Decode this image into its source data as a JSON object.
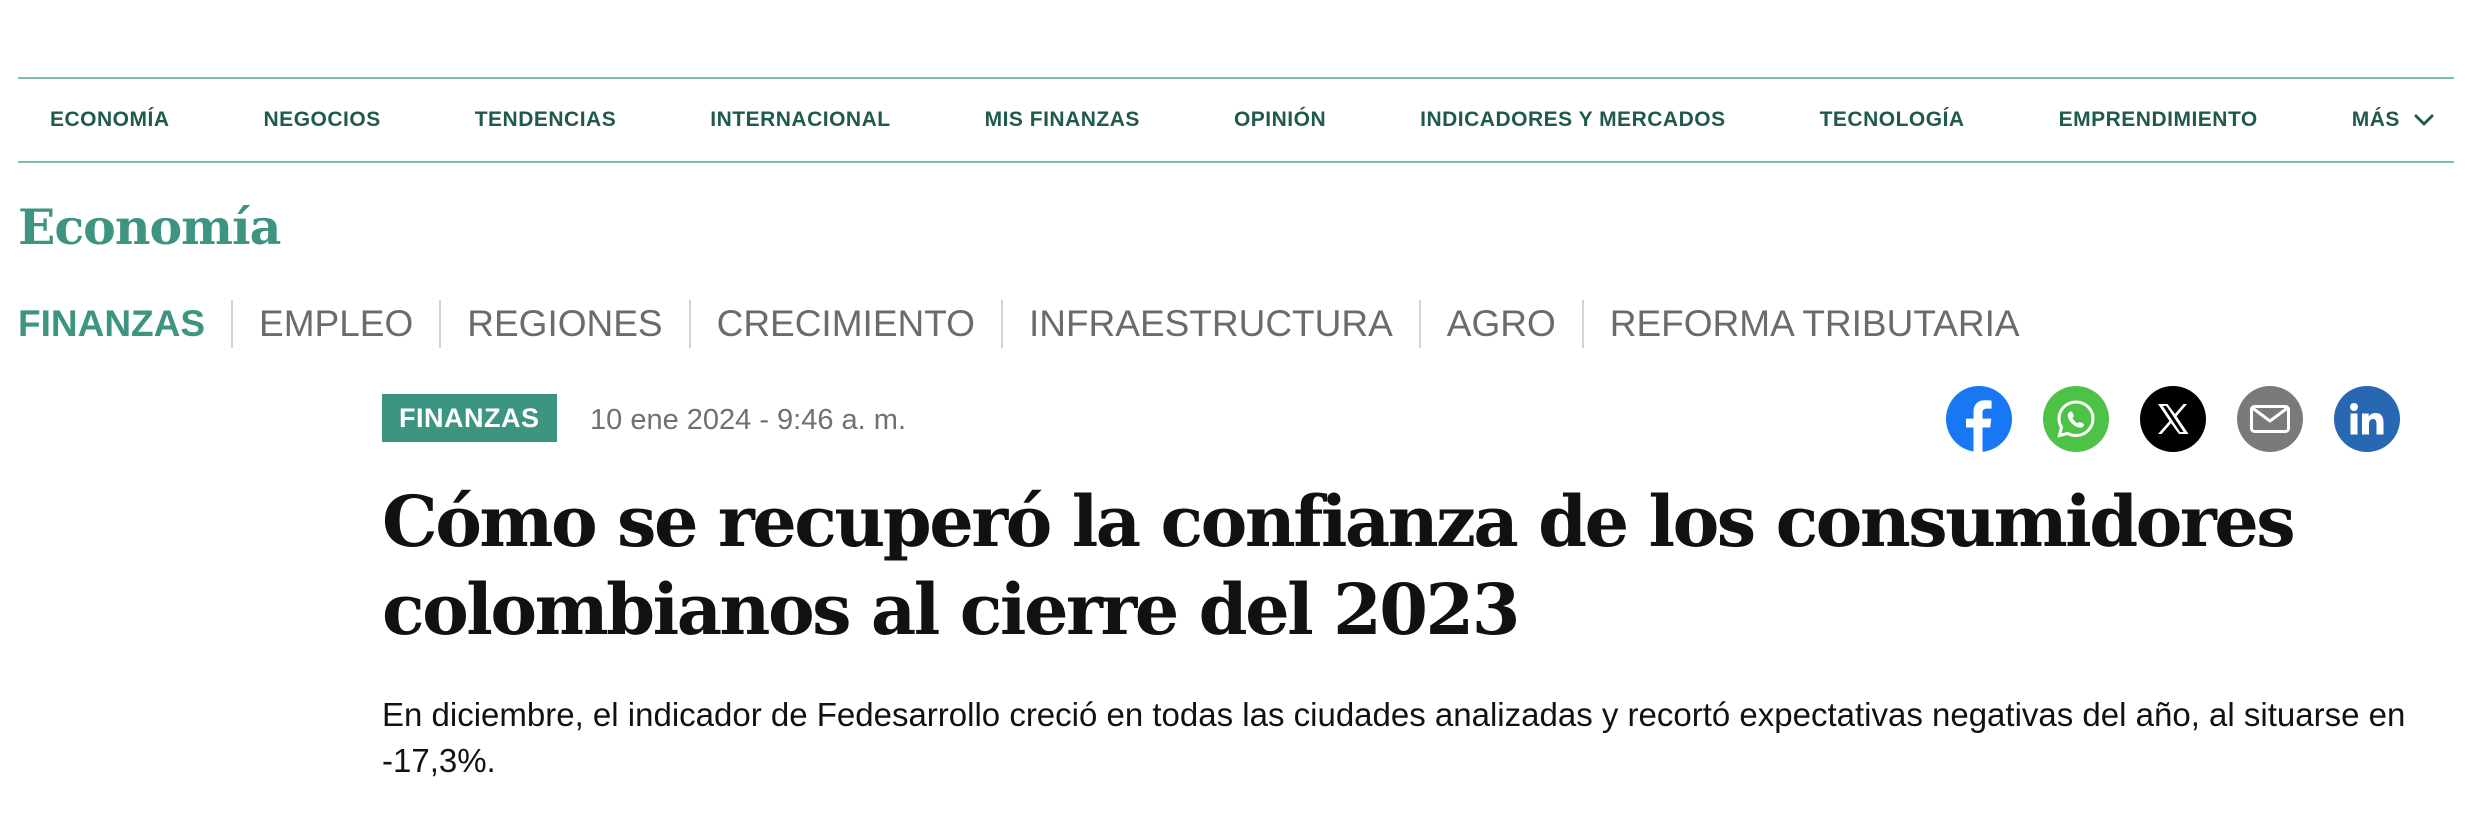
{
  "topnav": {
    "items": [
      "ECONOMÍA",
      "NEGOCIOS",
      "TENDENCIAS",
      "INTERNACIONAL",
      "MIS FINANZAS",
      "OPINIÓN",
      "INDICADORES Y MERCADOS",
      "TECNOLOGÍA",
      "EMPRENDIMIENTO"
    ],
    "more_label": "MÁS",
    "more_icon": "chevron-down-icon"
  },
  "section": {
    "title": "Economía"
  },
  "subnav": {
    "items": [
      "FINANZAS",
      "EMPLEO",
      "REGIONES",
      "CRECIMIENTO",
      "INFRAESTRUCTURA",
      "AGRO",
      "REFORMA TRIBUTARIA"
    ],
    "active": "FINANZAS"
  },
  "article": {
    "category": "FINANZAS",
    "date": "10 ene 2024 - 9:46 a. m.",
    "headline": "Cómo se recuperó la confianza de los consumidores colombianos al cierre del 2023",
    "summary": "En diciembre, el indicador de Fedesarrollo creció en todas las ciudades analizadas y recortó expectativas negativas del año, al situarse en -17,3%."
  },
  "share": [
    {
      "icon": "facebook-icon",
      "color": "#1877f2"
    },
    {
      "icon": "whatsapp-icon",
      "color": "#4dc247"
    },
    {
      "icon": "x-icon",
      "color": "#000000"
    },
    {
      "icon": "email-icon",
      "color": "#7a7a7a"
    },
    {
      "icon": "linkedin-icon",
      "color": "#2867b2"
    }
  ],
  "colors": {
    "brand_green": "#3d9480",
    "nav_text": "#1f5a4c",
    "nav_border": "#7fbfab",
    "subnav_text": "#6b6b6b"
  }
}
